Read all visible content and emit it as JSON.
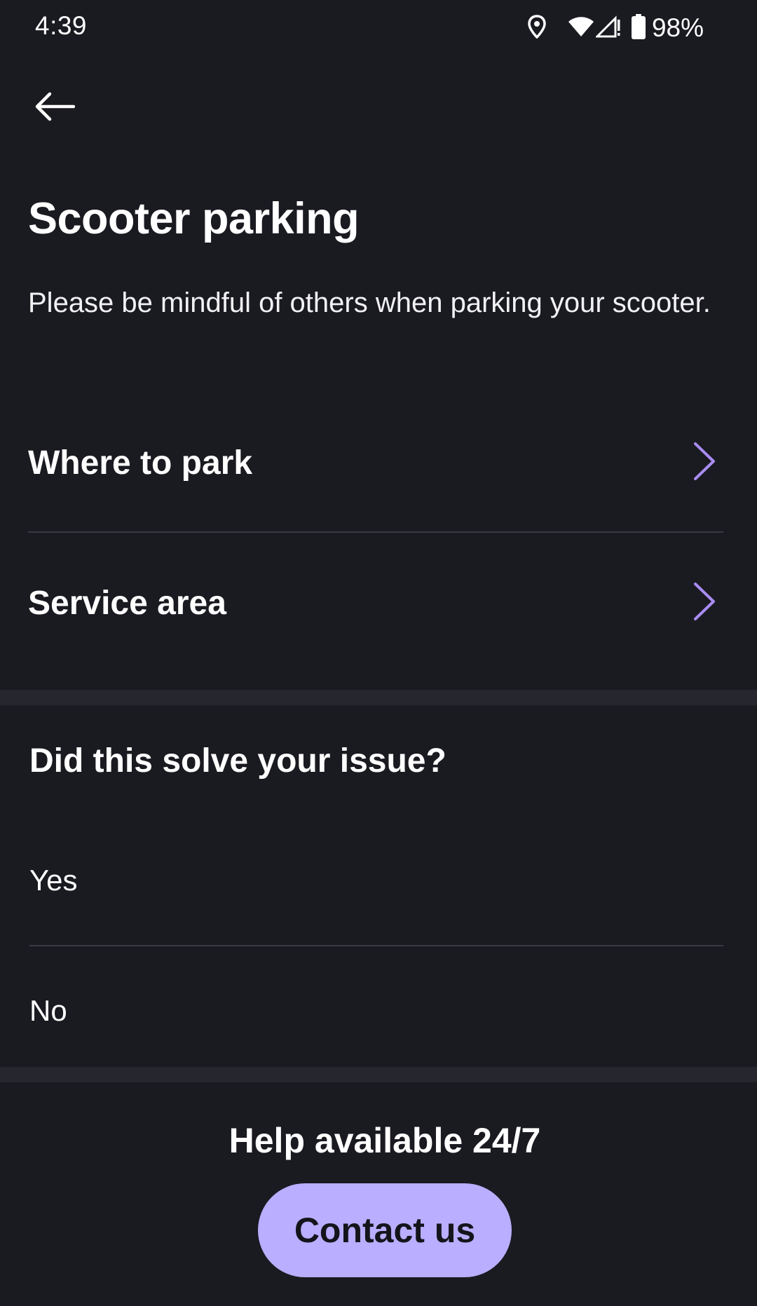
{
  "status_bar": {
    "time": "4:39",
    "battery_percent": "98%",
    "icons": [
      "location-icon",
      "wifi-icon",
      "signal-icon",
      "battery-icon"
    ]
  },
  "header": {
    "back_icon": "arrow-left-icon",
    "title": "Scooter parking",
    "subtitle": "Please be mindful of others when parking your scooter."
  },
  "nav_items": [
    {
      "label": "Where to park",
      "icon": "chevron-right-icon"
    },
    {
      "label": "Service area",
      "icon": "chevron-right-icon"
    }
  ],
  "feedback": {
    "question": "Did this solve your issue?",
    "options": [
      "Yes",
      "No"
    ]
  },
  "help": {
    "text": "Help available 24/7",
    "contact_label": "Contact us"
  },
  "colors": {
    "background": "#1a1a21",
    "accent": "#b9aeff",
    "chevron": "#a98cf2",
    "divider": "#3a3a44",
    "band": "#26262e"
  }
}
